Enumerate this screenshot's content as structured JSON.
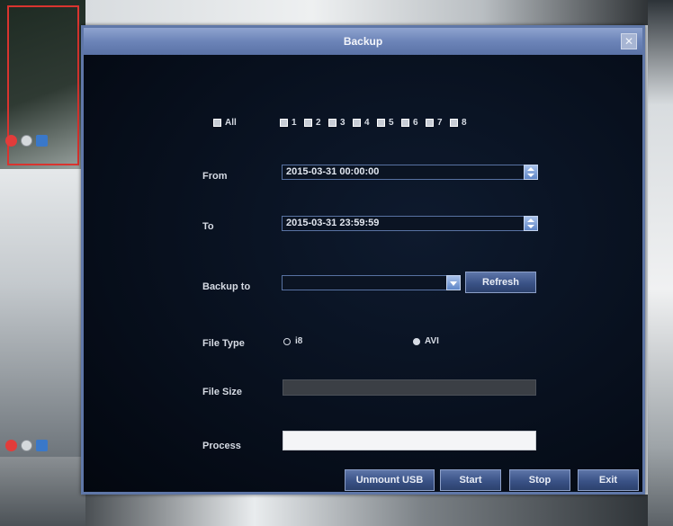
{
  "dialog": {
    "title": "Backup",
    "close_icon": "close-icon"
  },
  "channels": {
    "all_label": "All",
    "items": [
      "1",
      "2",
      "3",
      "4",
      "5",
      "6",
      "7",
      "8"
    ]
  },
  "from": {
    "label": "From",
    "value": "2015-03-31 00:00:00"
  },
  "to": {
    "label": "To",
    "value": "2015-03-31 23:59:59"
  },
  "backup_to": {
    "label": "Backup to",
    "value": "",
    "refresh_label": "Refresh"
  },
  "file_type": {
    "label": "File Type",
    "options": [
      "i8",
      "AVI"
    ],
    "selected": "AVI"
  },
  "file_size": {
    "label": "File Size",
    "value": ""
  },
  "process": {
    "label": "Process"
  },
  "footer": {
    "unmount_label": "Unmount USB",
    "start_label": "Start",
    "stop_label": "Stop",
    "exit_label": "Exit"
  },
  "colors": {
    "dialog_bg": "#08111f",
    "titlebar": "#6c84b8",
    "button": "#3a5286"
  }
}
